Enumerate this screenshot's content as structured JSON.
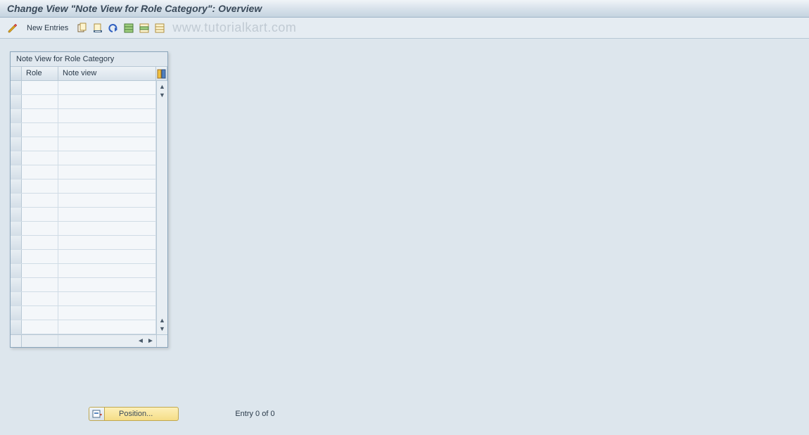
{
  "title": "Change View \"Note View for Role Category\": Overview",
  "toolbar": {
    "new_entries_label": "New Entries"
  },
  "watermark": "www.tutorialkart.com",
  "table": {
    "title": "Note View for Role Category",
    "columns": {
      "role": "Role",
      "noteview": "Note view"
    },
    "row_count": 18
  },
  "footer": {
    "position_label": "Position...",
    "entry_text": "Entry 0 of 0"
  }
}
